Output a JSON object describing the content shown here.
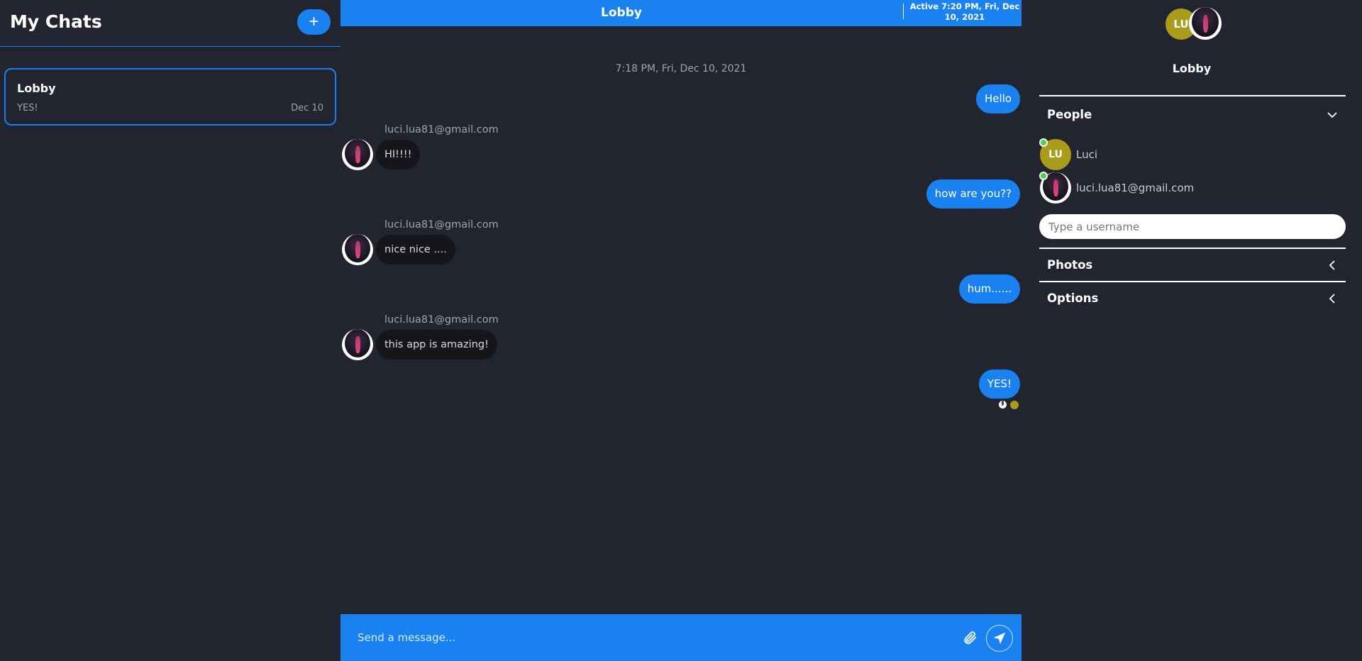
{
  "sidebar": {
    "title": "My Chats",
    "new_chat_label": "+",
    "chats": [
      {
        "title": "Lobby",
        "last_message": "YES!",
        "date": "Dec 10"
      }
    ]
  },
  "chat": {
    "title": "Lobby",
    "active_status": "Active 7:20 PM, Fri, Dec 10, 2021",
    "timestamp": "7:18 PM, Fri, Dec 10, 2021",
    "messages": [
      {
        "from": "me",
        "text": "Hello"
      },
      {
        "from": "luci.lua81@gmail.com",
        "text": "HI!!!!"
      },
      {
        "from": "me",
        "text": "how are you??"
      },
      {
        "from": "luci.lua81@gmail.com",
        "text": "nice nice ...."
      },
      {
        "from": "me",
        "text": "hum......"
      },
      {
        "from": "luci.lua81@gmail.com",
        "text": "this app is amazing!"
      },
      {
        "from": "me",
        "text": "YES!"
      }
    ],
    "composer": {
      "placeholder": "Send a message...",
      "attach_icon": "paperclip-icon",
      "send_icon": "paper-plane-icon"
    }
  },
  "details": {
    "header_avatar_initials": "LU",
    "title": "Lobby",
    "sections": {
      "people": "People",
      "photos": "Photos",
      "options": "Options"
    },
    "people": [
      {
        "initials": "LU",
        "name": "Luci",
        "online": true
      },
      {
        "name": "luci.lua81@gmail.com",
        "online": true
      }
    ],
    "username_placeholder": "Type a username"
  },
  "colors": {
    "background": "#22252f",
    "accent": "#1a82f0",
    "other_bubble": "#14161c",
    "avatar_lu": "#a89c1a",
    "online": "#4bd14b"
  }
}
